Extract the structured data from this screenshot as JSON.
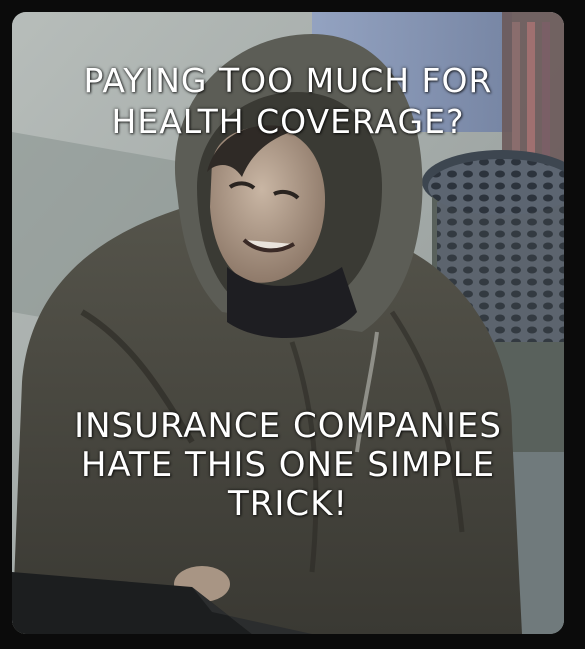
{
  "meme": {
    "top_caption": [
      "PAYING TOO MUCH FOR",
      "HEALTH COVERAGE?"
    ],
    "bottom_caption": [
      "INSURANCE COMPANIES",
      "HATE THIS ONE SIMPLE",
      "TRICK!"
    ]
  },
  "colors": {
    "background": "#0b0b0b",
    "jacket": "#4b4a42",
    "hood": "#5a5b54",
    "wall": "#a9b0ad",
    "text": "#ffffff"
  }
}
